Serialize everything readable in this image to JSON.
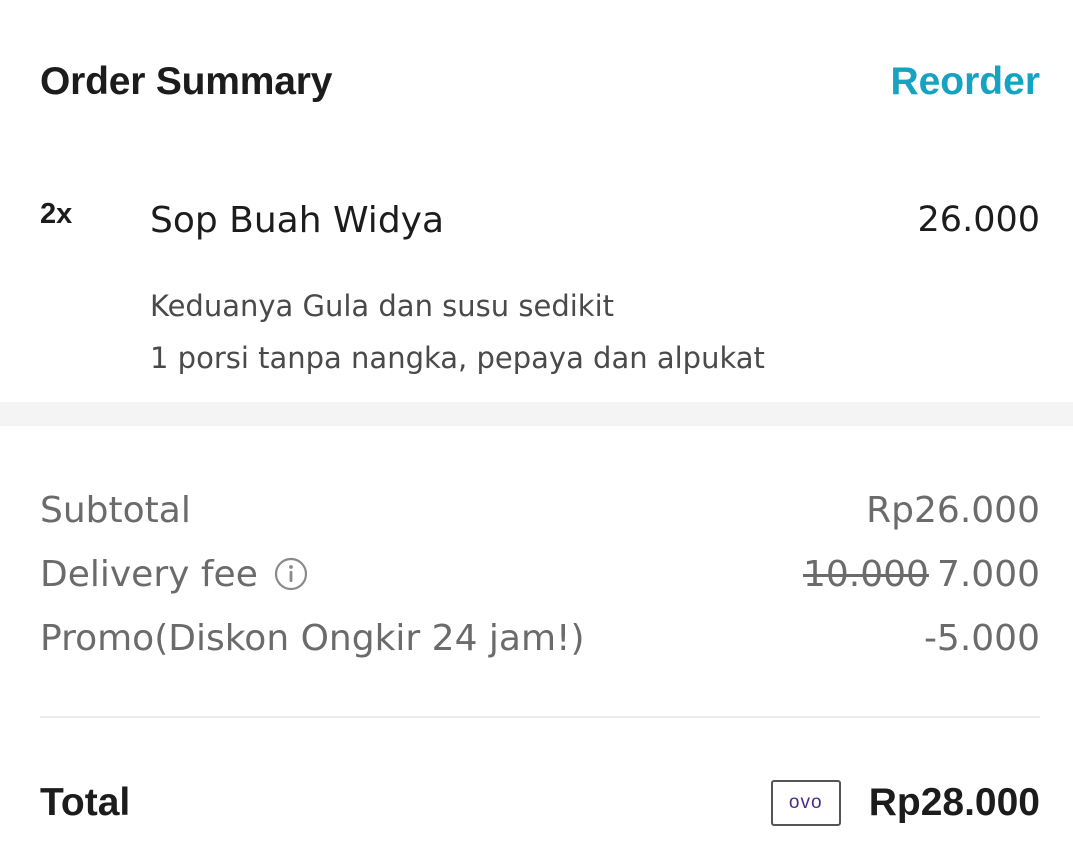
{
  "header": {
    "title": "Order Summary",
    "reorder_label": "Reorder"
  },
  "item": {
    "quantity": "2x",
    "name": "Sop Buah Widya",
    "price": "26.000",
    "notes": [
      "Keduanya Gula dan susu sedikit",
      "1 porsi tanpa nangka, pepaya dan alpukat"
    ]
  },
  "summary": {
    "subtotal_label": "Subtotal",
    "subtotal_value": "Rp26.000",
    "delivery_label": "Delivery fee",
    "delivery_icon": "info-icon",
    "delivery_original": "10.000",
    "delivery_value": "7.000",
    "promo_label": "Promo(Diskon Ongkir 24 jam!)",
    "promo_value": "-5.000"
  },
  "total": {
    "label": "Total",
    "payment_badge": "ovo",
    "value": "Rp28.000"
  },
  "colors": {
    "accent": "#16a3c2",
    "ovo": "#4c2a86"
  }
}
